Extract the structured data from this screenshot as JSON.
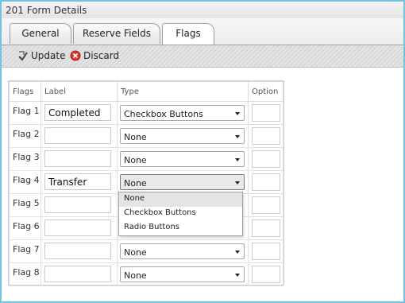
{
  "window": {
    "title": "201 Form Details"
  },
  "tabs": [
    {
      "label": "General"
    },
    {
      "label": "Reserve Fields"
    },
    {
      "label": "Flags",
      "active": true
    }
  ],
  "toolbar": {
    "update_label": "Update",
    "discard_label": "Discard"
  },
  "grid": {
    "headers": {
      "flags": "Flags",
      "label": "Label",
      "type": "Type",
      "option": "Option"
    },
    "rows": [
      {
        "flag": "Flag 1",
        "label": "Completed",
        "type": "Checkbox Buttons"
      },
      {
        "flag": "Flag 2",
        "label": "",
        "type": "None"
      },
      {
        "flag": "Flag 3",
        "label": "",
        "type": "None"
      },
      {
        "flag": "Flag 4",
        "label": "Transfer",
        "type": "None"
      },
      {
        "flag": "Flag 5",
        "label": "",
        "type": ""
      },
      {
        "flag": "Flag 6",
        "label": "",
        "type": ""
      },
      {
        "flag": "Flag 7",
        "label": "",
        "type": "None"
      },
      {
        "flag": "Flag 8",
        "label": "",
        "type": "None"
      }
    ]
  },
  "dropdown": {
    "options": [
      "None",
      "Checkbox Buttons",
      "Radio Buttons"
    ],
    "highlighted": "None"
  },
  "colors": {
    "frame_border": "#6fc3e3",
    "discard_icon": "#d8322b",
    "highlight": "#e4e4e4"
  }
}
